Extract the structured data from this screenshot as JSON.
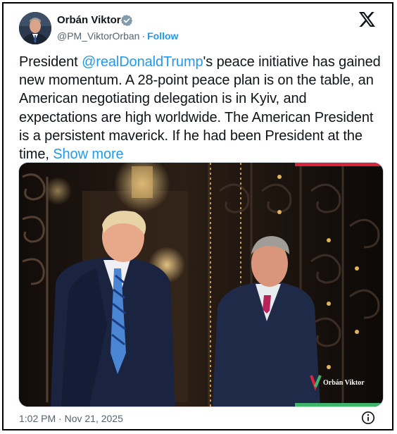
{
  "author": {
    "name": "Orbán Viktor",
    "handle": "@PM_ViktorOrban",
    "separator": "·",
    "follow_label": "Follow",
    "verified": true,
    "avatar_icon": "user-portrait"
  },
  "brand_icon": "x-logo",
  "tweet": {
    "prefix": "President ",
    "mention": "@realDonaldTrump",
    "body": "'s peace initiative has gained new momentum. A 28-point peace plan is on the table, an American negotiating delegation is in Kyiv, and expectations are high worldwide. The American President is a persistent maverick. If he had been President at the time, ",
    "show_more": "Show more"
  },
  "media": {
    "watermark": "Orbán Viktor",
    "accent_colors": [
      "#d9253b",
      "#3eb56b"
    ]
  },
  "footer": {
    "timestamp": "1:02 PM · Nov 21, 2025",
    "info_icon": "info-icon"
  },
  "colors": {
    "link": "#1d9bf0",
    "text": "#0f1419",
    "muted": "#536471",
    "verified": "#829aab"
  }
}
